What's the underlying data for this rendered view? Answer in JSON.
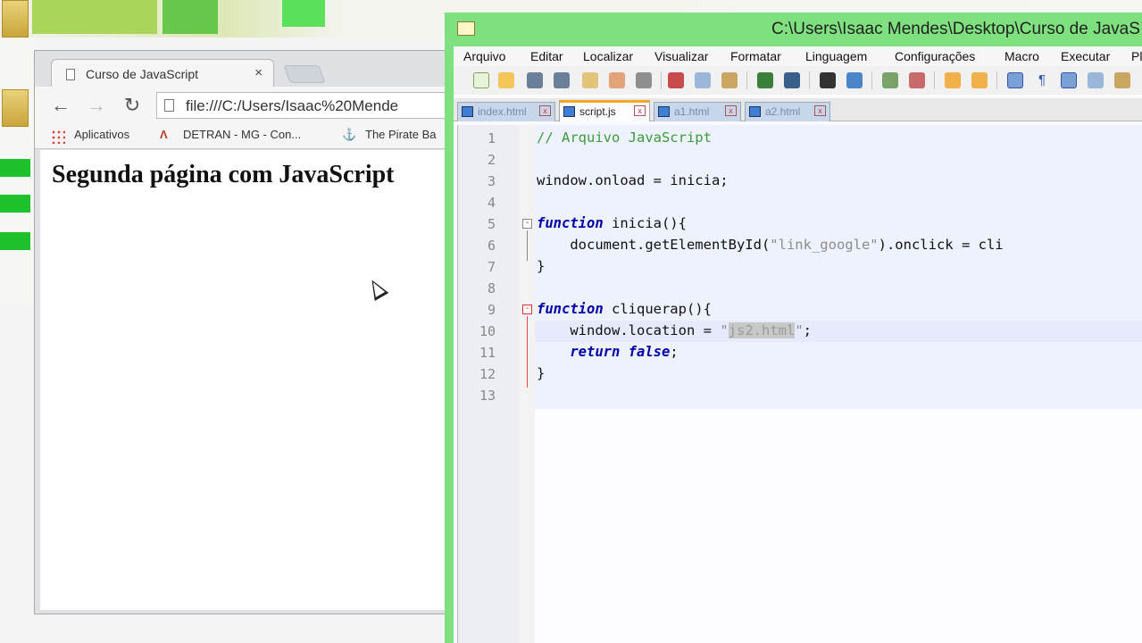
{
  "chrome": {
    "tab_title": "Curso de JavaScript",
    "tab_close": "×",
    "address": "file:///C:/Users/Isaac%20Mende",
    "bookmarks": [
      "Aplicativos",
      "DETRAN - MG - Con...",
      "The Pirate Ba"
    ],
    "page_heading": "Segunda página com JavaScript"
  },
  "notepad": {
    "title": "C:\\Users\\Isaac Mendes\\Desktop\\Curso de JavaS",
    "menu": [
      "Arquivo",
      "Editar",
      "Localizar",
      "Visualizar",
      "Formatar",
      "Linguagem",
      "Configurações",
      "Macro",
      "Executar",
      "Pl"
    ],
    "tabs": [
      {
        "label": "index.html",
        "active": false
      },
      {
        "label": "script.js",
        "active": true
      },
      {
        "label": "a1.html",
        "active": false
      },
      {
        "label": "a2.html",
        "active": false
      }
    ],
    "line_numbers": [
      "1",
      "2",
      "3",
      "4",
      "5",
      "6",
      "7",
      "8",
      "9",
      "10",
      "11",
      "12",
      "13"
    ],
    "code": {
      "l1": "// Arquivo JavaScript",
      "l3": "window.onload = inicia;",
      "l5_kw": "function",
      "l5_rest": " inicia(){",
      "l6_a": "    document.getElementById(",
      "l6_str": "\"link_google\"",
      "l6_b": ").onclick = cli",
      "l7": "}",
      "l9_kw": "function",
      "l9_rest": " cliquerap(){",
      "l10_a": "    window.location = ",
      "l10_q1": "\"",
      "l10_sel": "js2.html",
      "l10_q2": "\"",
      "l10_b": ";",
      "l11_pre": "    ",
      "l11_kw": "return false",
      "l11_b": ";",
      "l12": "}"
    }
  },
  "colors": {
    "notepad_frame": "#7ee07e",
    "keyword": "#0000a8",
    "comment": "#3c9a3c",
    "string": "#8c8c8c"
  }
}
